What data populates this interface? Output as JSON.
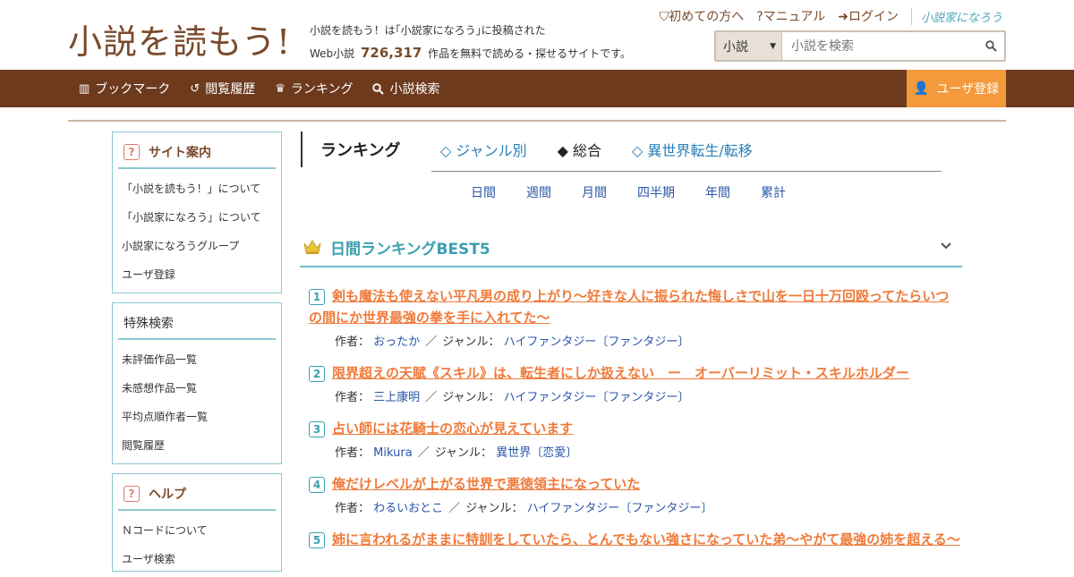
{
  "header": {
    "logo": "小説を読もう!",
    "tagline_line1": "小説を読もう！は｢小説家になろう｣に投稿された",
    "tagline_prefix": "Web小説",
    "tagline_count": "726,317",
    "tagline_suffix": "作品を無料で読める・探せるサイトです。",
    "links": {
      "first": "初めての方へ",
      "manual": "マニュアル",
      "login": "ログイン",
      "naro": "小説家になろう"
    },
    "search": {
      "category": "小説",
      "placeholder": "小説を検索"
    }
  },
  "nav": {
    "items": [
      "ブックマーク",
      "閲覧履歴",
      "ランキング",
      "小説検索"
    ],
    "register": "ユーザ登録"
  },
  "sidebar": {
    "guide": {
      "title": "サイト案内",
      "items": [
        "「小説を読もう！」について",
        "「小説家になろう」について",
        "小説家になろうグループ",
        "ユーザ登録"
      ]
    },
    "special": {
      "title": "特殊検索",
      "items": [
        "未評価作品一覧",
        "未感想作品一覧",
        "平均点順作者一覧",
        "閲覧履歴"
      ]
    },
    "help": {
      "title": "ヘルプ",
      "items": [
        "Ｎコードについて",
        "ユーザ検索"
      ]
    }
  },
  "ranking": {
    "title": "ランキング",
    "tabs": [
      "◇ ジャンル別",
      "◆ 総合",
      "◇ 異世界転生/転移"
    ],
    "periods": [
      "日間",
      "週間",
      "月間",
      "四半期",
      "年間",
      "累計"
    ],
    "best_title": "日間ランキングBEST5",
    "author_label": "作者：",
    "genre_label": "ジャンル：",
    "entries": [
      {
        "rank": "1",
        "title": "剣も魔法も使えない平凡男の成り上がり〜好きな人に振られた悔しさで山を一日十万回殴ってたらいつの間にか世界最強の拳を手に入れてた〜",
        "author": "おったか",
        "genre": "ハイファンタジー〔ファンタジー〕"
      },
      {
        "rank": "2",
        "title": "限界超えの天賦《スキル》は、転生者にしか扱えない　ー　オーバーリミット・スキルホルダー",
        "author": "三上康明",
        "genre": "ハイファンタジー〔ファンタジー〕"
      },
      {
        "rank": "3",
        "title": "占い師には花騎士の恋心が見えています",
        "author": "Mikura",
        "genre": "異世界〔恋愛〕"
      },
      {
        "rank": "4",
        "title": "俺だけレベルが上がる世界で悪徳領主になっていた",
        "author": "わるいおとこ",
        "genre": "ハイファンタジー〔ファンタジー〕"
      },
      {
        "rank": "5",
        "title": "姉に言われるがままに特訓をしていたら、とんでもない強さになっていた弟～やがて最強の姉を超える～",
        "author": "",
        "genre": ""
      }
    ]
  }
}
